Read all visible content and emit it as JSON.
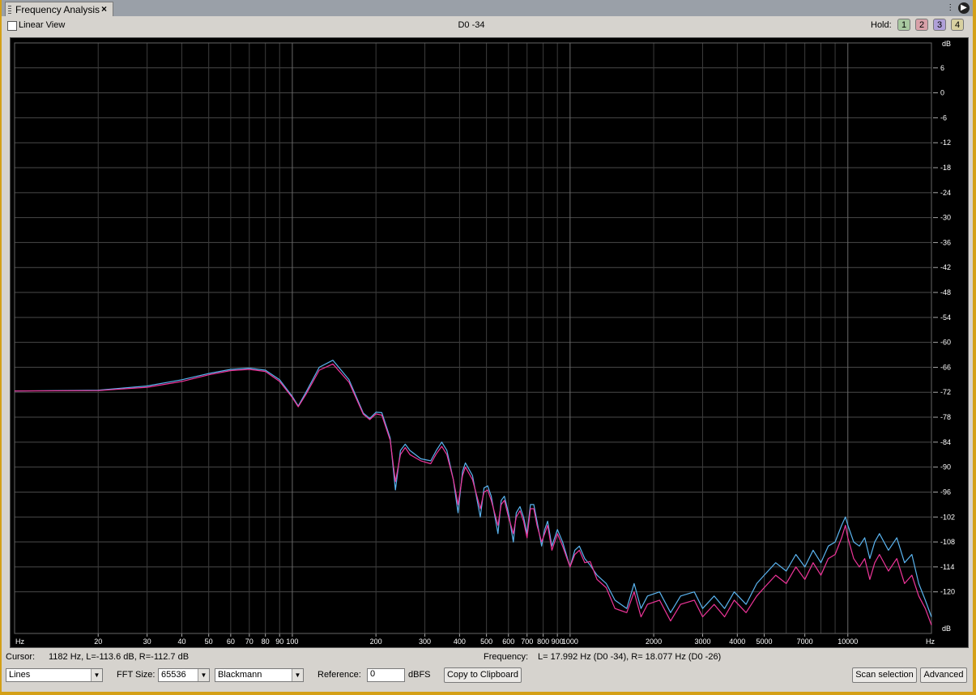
{
  "tab": {
    "title": "Frequency Analysis",
    "close_label": "×"
  },
  "toolbar": {
    "linear_view_label": "Linear View",
    "center_readout": "D0 -34",
    "hold_label": "Hold:",
    "hold_buttons": [
      {
        "label": "1",
        "color": "#a8c8a0"
      },
      {
        "label": "2",
        "color": "#d8a0a8"
      },
      {
        "label": "3",
        "color": "#b0a0d8"
      },
      {
        "label": "4",
        "color": "#d8d0a0"
      }
    ]
  },
  "status": {
    "cursor_label": "Cursor:",
    "cursor_value": "1182 Hz, L=-113.6 dB, R=-112.7 dB",
    "frequency_label": "Frequency:",
    "frequency_value": "L= 17.992 Hz (D0 -34), R= 18.077 Hz (D0 -26)"
  },
  "controls": {
    "display_mode": "Lines",
    "fft_size_label": "FFT Size:",
    "fft_size": "65536",
    "window": "Blackmann",
    "reference_label": "Reference:",
    "reference_value": "0",
    "reference_unit": "dBFS",
    "copy_button": "Copy to Clipboard",
    "scan_button": "Scan selection",
    "advanced_button": "Advanced"
  },
  "chart_data": {
    "type": "line",
    "x_scale": "log",
    "xlim": [
      10,
      20000
    ],
    "ylim": [
      -130,
      12
    ],
    "ylabel": "dB",
    "xlabel": "Hz",
    "x_label_left": "Hz",
    "x_label_right": "Hz",
    "y_unit_top": "dB",
    "y_unit_bottom": "dB",
    "y_ticks": [
      6,
      0,
      -6,
      -12,
      -18,
      -24,
      -30,
      -36,
      -42,
      -48,
      -54,
      -60,
      -66,
      -72,
      -78,
      -84,
      -90,
      -96,
      -102,
      -108,
      -114,
      -120
    ],
    "x_tick_labels": [
      {
        "v": 20,
        "t": "20"
      },
      {
        "v": 30,
        "t": "30"
      },
      {
        "v": 40,
        "t": "40"
      },
      {
        "v": 50,
        "t": "50"
      },
      {
        "v": 60,
        "t": "60"
      },
      {
        "v": 70,
        "t": "70"
      },
      {
        "v": 80,
        "t": "80"
      },
      {
        "v": 90,
        "t": "90"
      },
      {
        "v": 100,
        "t": "100"
      },
      {
        "v": 200,
        "t": "200"
      },
      {
        "v": 300,
        "t": "300"
      },
      {
        "v": 400,
        "t": "400"
      },
      {
        "v": 500,
        "t": "500"
      },
      {
        "v": 600,
        "t": "600"
      },
      {
        "v": 700,
        "t": "700"
      },
      {
        "v": 800,
        "t": "800"
      },
      {
        "v": 900,
        "t": "900"
      },
      {
        "v": 1000,
        "t": "1000"
      },
      {
        "v": 2000,
        "t": "2000"
      },
      {
        "v": 3000,
        "t": "3000"
      },
      {
        "v": 4000,
        "t": "4000"
      },
      {
        "v": 5000,
        "t": "5000"
      },
      {
        "v": 7000,
        "t": "7000"
      },
      {
        "v": 10000,
        "t": "10000"
      }
    ],
    "grid": true,
    "series": [
      {
        "color": "#5ab4f0",
        "points": [
          [
            10,
            -71.7
          ],
          [
            20,
            -71.5
          ],
          [
            30,
            -70.5
          ],
          [
            40,
            -69
          ],
          [
            50,
            -67.5
          ],
          [
            60,
            -66.5
          ],
          [
            70,
            -66.2
          ],
          [
            80,
            -66.7
          ],
          [
            90,
            -69
          ],
          [
            100,
            -73
          ],
          [
            105,
            -75.3
          ],
          [
            112,
            -72
          ],
          [
            125,
            -66
          ],
          [
            140,
            -64.3
          ],
          [
            160,
            -69
          ],
          [
            180,
            -77
          ],
          [
            190,
            -78.3
          ],
          [
            200,
            -76.8
          ],
          [
            210,
            -76.9
          ],
          [
            225,
            -83
          ],
          [
            235,
            -95.5
          ],
          [
            245,
            -86
          ],
          [
            255,
            -84.5
          ],
          [
            265,
            -86
          ],
          [
            290,
            -88
          ],
          [
            315,
            -88.5
          ],
          [
            330,
            -86
          ],
          [
            345,
            -84
          ],
          [
            360,
            -86
          ],
          [
            380,
            -93
          ],
          [
            395,
            -101
          ],
          [
            410,
            -91
          ],
          [
            420,
            -89
          ],
          [
            445,
            -92
          ],
          [
            475,
            -102
          ],
          [
            490,
            -95
          ],
          [
            505,
            -94.5
          ],
          [
            520,
            -97
          ],
          [
            550,
            -106
          ],
          [
            565,
            -98
          ],
          [
            580,
            -97
          ],
          [
            600,
            -101
          ],
          [
            625,
            -108
          ],
          [
            640,
            -101
          ],
          [
            660,
            -99.5
          ],
          [
            680,
            -102
          ],
          [
            700,
            -106
          ],
          [
            720,
            -99
          ],
          [
            740,
            -99
          ],
          [
            760,
            -103
          ],
          [
            790,
            -109
          ],
          [
            810,
            -105
          ],
          [
            830,
            -103
          ],
          [
            860,
            -109
          ],
          [
            900,
            -105
          ],
          [
            940,
            -108
          ],
          [
            1000,
            -114
          ],
          [
            1040,
            -110
          ],
          [
            1080,
            -109
          ],
          [
            1130,
            -112
          ],
          [
            1182,
            -113.6
          ],
          [
            1250,
            -116
          ],
          [
            1350,
            -118
          ],
          [
            1450,
            -122
          ],
          [
            1600,
            -124
          ],
          [
            1700,
            -118
          ],
          [
            1800,
            -124
          ],
          [
            1900,
            -121
          ],
          [
            2100,
            -120
          ],
          [
            2300,
            -125
          ],
          [
            2500,
            -121
          ],
          [
            2800,
            -120
          ],
          [
            3000,
            -124
          ],
          [
            3300,
            -121
          ],
          [
            3600,
            -124
          ],
          [
            3900,
            -120
          ],
          [
            4300,
            -123
          ],
          [
            4700,
            -118
          ],
          [
            5000,
            -116
          ],
          [
            5500,
            -113
          ],
          [
            6000,
            -115
          ],
          [
            6500,
            -111
          ],
          [
            7000,
            -114
          ],
          [
            7500,
            -110
          ],
          [
            8000,
            -113
          ],
          [
            8500,
            -109
          ],
          [
            9000,
            -108
          ],
          [
            9500,
            -104
          ],
          [
            9800,
            -102
          ],
          [
            10000,
            -104
          ],
          [
            10500,
            -108
          ],
          [
            11000,
            -109
          ],
          [
            11500,
            -107
          ],
          [
            12000,
            -112
          ],
          [
            12500,
            -108
          ],
          [
            13000,
            -106
          ],
          [
            14000,
            -110
          ],
          [
            15000,
            -107
          ],
          [
            16000,
            -113
          ],
          [
            17000,
            -111
          ],
          [
            18000,
            -118
          ],
          [
            19000,
            -122
          ],
          [
            20000,
            -126
          ]
        ]
      },
      {
        "color": "#f0359a",
        "points": [
          [
            10,
            -71.7
          ],
          [
            20,
            -71.6
          ],
          [
            30,
            -70.8
          ],
          [
            40,
            -69.4
          ],
          [
            50,
            -67.8
          ],
          [
            60,
            -66.8
          ],
          [
            70,
            -66.5
          ],
          [
            80,
            -67
          ],
          [
            90,
            -69.4
          ],
          [
            100,
            -73.3
          ],
          [
            105,
            -75.5
          ],
          [
            112,
            -72.5
          ],
          [
            125,
            -66.7
          ],
          [
            140,
            -65.2
          ],
          [
            160,
            -69.6
          ],
          [
            180,
            -77.3
          ],
          [
            190,
            -78.6
          ],
          [
            200,
            -77.2
          ],
          [
            210,
            -77.5
          ],
          [
            225,
            -83.5
          ],
          [
            235,
            -93.5
          ],
          [
            245,
            -87
          ],
          [
            255,
            -85.3
          ],
          [
            265,
            -87
          ],
          [
            290,
            -88.5
          ],
          [
            315,
            -89.2
          ],
          [
            330,
            -86.8
          ],
          [
            345,
            -85
          ],
          [
            360,
            -87
          ],
          [
            380,
            -93
          ],
          [
            395,
            -99
          ],
          [
            410,
            -92
          ],
          [
            420,
            -90
          ],
          [
            445,
            -93
          ],
          [
            475,
            -100
          ],
          [
            490,
            -96
          ],
          [
            505,
            -95.5
          ],
          [
            520,
            -98
          ],
          [
            550,
            -104
          ],
          [
            565,
            -99
          ],
          [
            580,
            -98
          ],
          [
            600,
            -102
          ],
          [
            625,
            -106
          ],
          [
            640,
            -102
          ],
          [
            660,
            -100.5
          ],
          [
            680,
            -103
          ],
          [
            700,
            -107
          ],
          [
            720,
            -100
          ],
          [
            740,
            -100
          ],
          [
            760,
            -104
          ],
          [
            790,
            -108
          ],
          [
            810,
            -106
          ],
          [
            830,
            -104
          ],
          [
            860,
            -110
          ],
          [
            900,
            -106
          ],
          [
            940,
            -109
          ],
          [
            1000,
            -114
          ],
          [
            1040,
            -111
          ],
          [
            1080,
            -110
          ],
          [
            1130,
            -113
          ],
          [
            1182,
            -112.7
          ],
          [
            1250,
            -117
          ],
          [
            1350,
            -119
          ],
          [
            1450,
            -124
          ],
          [
            1600,
            -125
          ],
          [
            1700,
            -120
          ],
          [
            1800,
            -126
          ],
          [
            1900,
            -123
          ],
          [
            2100,
            -122
          ],
          [
            2300,
            -127
          ],
          [
            2500,
            -123
          ],
          [
            2800,
            -122
          ],
          [
            3000,
            -126
          ],
          [
            3300,
            -123
          ],
          [
            3600,
            -126
          ],
          [
            3900,
            -122
          ],
          [
            4300,
            -125
          ],
          [
            4700,
            -121
          ],
          [
            5000,
            -119
          ],
          [
            5500,
            -116
          ],
          [
            6000,
            -118
          ],
          [
            6500,
            -114
          ],
          [
            7000,
            -117
          ],
          [
            7500,
            -113
          ],
          [
            8000,
            -116
          ],
          [
            8500,
            -112
          ],
          [
            9000,
            -111
          ],
          [
            9500,
            -107
          ],
          [
            9800,
            -104
          ],
          [
            10000,
            -107
          ],
          [
            10500,
            -112
          ],
          [
            11000,
            -114
          ],
          [
            11500,
            -112
          ],
          [
            12000,
            -117
          ],
          [
            12500,
            -113
          ],
          [
            13000,
            -111
          ],
          [
            14000,
            -115
          ],
          [
            15000,
            -112
          ],
          [
            16000,
            -118
          ],
          [
            17000,
            -116
          ],
          [
            18000,
            -121
          ],
          [
            19000,
            -124
          ],
          [
            20000,
            -128
          ]
        ]
      }
    ]
  }
}
